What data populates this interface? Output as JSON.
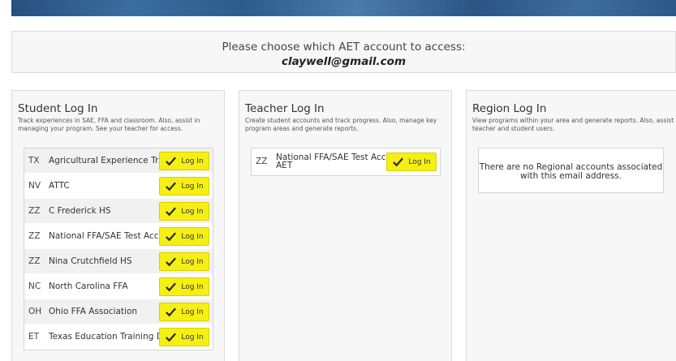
{
  "header": {
    "prompt": "Please choose which AET account to access:",
    "email": "claywell@gmail.com"
  },
  "student": {
    "title": "Student Log In",
    "description": "Track experiences in SAE, FFA and classroom. Also, assist in managing your program. See your teacher for access.",
    "accounts": [
      {
        "state": "TX",
        "name": "Agricultural Experience Tracker"
      },
      {
        "state": "NV",
        "name": "ATTC"
      },
      {
        "state": "ZZ",
        "name": "C Frederick HS"
      },
      {
        "state": "ZZ",
        "name": "National FFA/SAE Test Account w/AET"
      },
      {
        "state": "ZZ",
        "name": "Nina Crutchfield HS"
      },
      {
        "state": "NC",
        "name": "North Carolina FFA"
      },
      {
        "state": "OH",
        "name": "Ohio FFA Association"
      },
      {
        "state": "ET",
        "name": "Texas Education Training Demo"
      }
    ]
  },
  "teacher": {
    "title": "Teacher Log In",
    "description": "Create student accounts and track progress. Also, manage key program areas and generate reports.",
    "accounts": [
      {
        "state": "ZZ",
        "name": "National FFA/SAE Test Account w/o AET"
      }
    ]
  },
  "region": {
    "title": "Region Log In",
    "description": "View programs within your area and generate reports. Also, assist teacher and student users.",
    "empty_message": "There are no Regional accounts associated with this email address."
  },
  "login_label": "Log In",
  "colors": {
    "login_button": "#f5ef14",
    "checkmark": "#2b2b2b",
    "banner": "#2c5c8e"
  },
  "icons": {
    "login_check": "checkmark-icon"
  }
}
